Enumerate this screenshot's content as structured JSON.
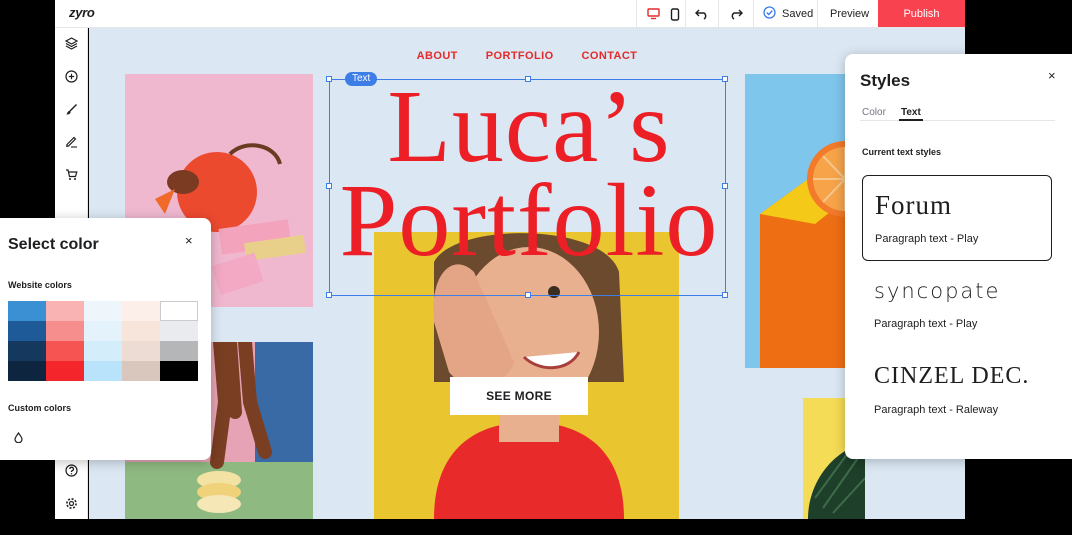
{
  "topbar": {
    "logo": "zyro",
    "saved_label": "Saved",
    "preview_label": "Preview",
    "publish_label": "Publish",
    "icons": [
      "desktop-icon",
      "mobile-icon",
      "undo-icon",
      "redo-icon",
      "check-circle-icon"
    ]
  },
  "sidebar": {
    "top_icons": [
      "layers-icon",
      "add-icon",
      "brush-icon",
      "pen-icon",
      "cart-icon"
    ],
    "bottom_icons": [
      "help-icon",
      "settings-icon"
    ]
  },
  "site": {
    "nav": [
      "ABOUT",
      "PORTFOLIO",
      "CONTACT"
    ],
    "title_line1": "Luca’s",
    "title_line2": "Portfolio",
    "selection_tag": "Text",
    "cta_label": "SEE MORE"
  },
  "color_panel": {
    "title": "Select color",
    "close": "×",
    "website_colors_label": "Website colors",
    "custom_colors_label": "Custom colors",
    "swatches": [
      "#3b8fd3",
      "#f9b3b3",
      "#eef6fb",
      "#fcefe9",
      "#ffffff",
      "#1d5a97",
      "#f78e8e",
      "#e3f2fb",
      "#f7e5dc",
      "#e9ebee",
      "#14385e",
      "#f65353",
      "#d4edfb",
      "#ecdcd3",
      "#b5b6b8",
      "#0e2540",
      "#f4262b",
      "#b9e3fa",
      "#d9c7bd",
      "#000000"
    ]
  },
  "styles_panel": {
    "title": "Styles",
    "close": "×",
    "tabs": [
      "Color",
      "Text"
    ],
    "active_tab": "Text",
    "section_label": "Current text styles",
    "cards": [
      {
        "font": "Forum",
        "sub": "Paragraph text - Play"
      },
      {
        "font": "syncopate",
        "sub": "Paragraph text - Play"
      },
      {
        "font": "CINZEL DEC.",
        "sub": "Paragraph text - Raleway"
      }
    ]
  },
  "colors": {
    "accent_red": "#ec1f26",
    "publish_red": "#f9424f",
    "selection_blue": "#3d7de6",
    "canvas_bg": "#dbe8f4"
  }
}
